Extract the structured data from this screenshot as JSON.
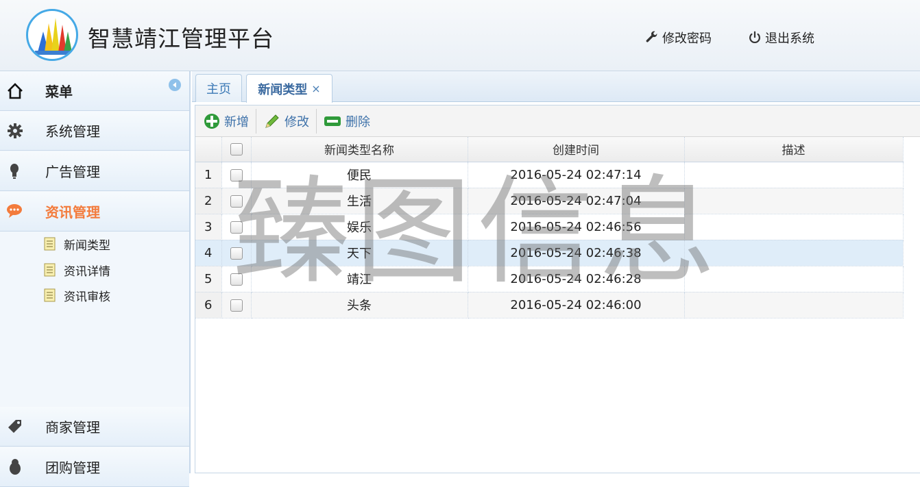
{
  "header": {
    "title": "智慧靖江管理平台",
    "change_password": "修改密码",
    "logout": "退出系统"
  },
  "sidebar": {
    "menu_label": "菜单",
    "items": [
      {
        "label": "系统管理",
        "icon": "gear-icon"
      },
      {
        "label": "广告管理",
        "icon": "bulb-icon"
      },
      {
        "label": "资讯管理",
        "icon": "chat-icon"
      },
      {
        "label": "商家管理",
        "icon": "tag-icon"
      },
      {
        "label": "团购管理",
        "icon": "bird-icon"
      }
    ],
    "sub_items": [
      {
        "label": "新闻类型"
      },
      {
        "label": "资讯详情"
      },
      {
        "label": "资讯审核"
      }
    ],
    "active_color": "#f37b3c"
  },
  "tabs": [
    {
      "label": "主页"
    },
    {
      "label": "新闻类型",
      "close": "×"
    }
  ],
  "toolbar": {
    "add": "新增",
    "edit": "修改",
    "delete": "删除"
  },
  "table": {
    "columns": [
      "新闻类型名称",
      "创建时间",
      "描述"
    ],
    "rows": [
      {
        "num": "1",
        "name": "便民",
        "time": "2016-05-24 02:47:14",
        "desc": ""
      },
      {
        "num": "2",
        "name": "生活",
        "time": "2016-05-24 02:47:04",
        "desc": ""
      },
      {
        "num": "3",
        "name": "娱乐",
        "time": "2016-05-24 02:46:56",
        "desc": ""
      },
      {
        "num": "4",
        "name": "天下",
        "time": "2016-05-24 02:46:38",
        "desc": ""
      },
      {
        "num": "5",
        "name": "靖江",
        "time": "2016-05-24 02:46:28",
        "desc": ""
      },
      {
        "num": "6",
        "name": "头条",
        "time": "2016-05-24 02:46:00",
        "desc": ""
      }
    ]
  },
  "watermark": "臻图信息"
}
